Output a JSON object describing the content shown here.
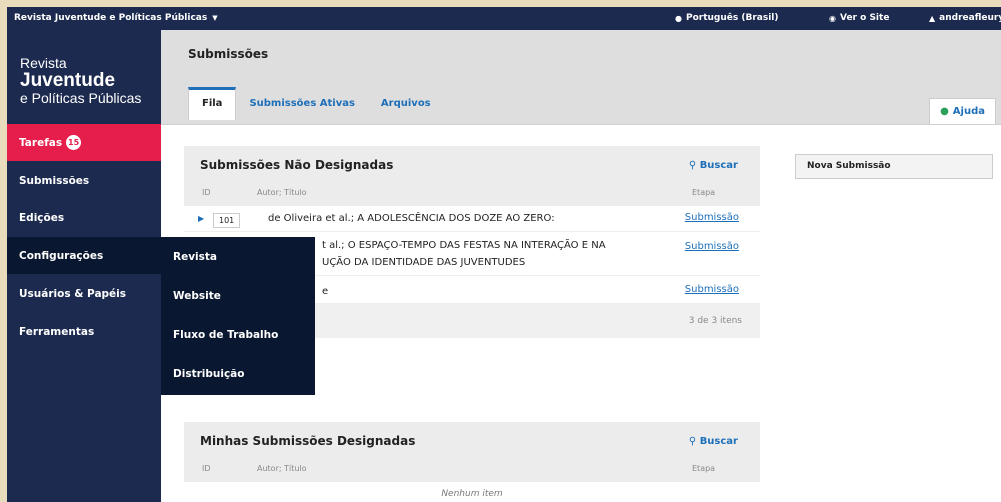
{
  "topbar": {
    "site_name": "Revista Juventude e Políticas Públicas",
    "language": "Português (Brasil)",
    "view_site": "Ver o Site",
    "user": "andreafleury"
  },
  "brand": {
    "line1": "Revista",
    "line2": "Juventude",
    "line3": "e Políticas Públicas"
  },
  "nav": {
    "tasks_label": "Tarefas",
    "tasks_count": "15",
    "items": [
      "Submissões",
      "Edições",
      "Configurações",
      "Usuários & Papéis",
      "Ferramentas"
    ]
  },
  "submenu": {
    "items": [
      "Revista",
      "Website",
      "Fluxo de Trabalho",
      "Distribuição"
    ]
  },
  "header": {
    "title": "Submissões",
    "tabs": [
      "Fila",
      "Submissões Ativas",
      "Arquivos"
    ],
    "help": "Ajuda"
  },
  "unassigned": {
    "title": "Submissões Não Designadas",
    "search": "Buscar",
    "col_id": "ID",
    "col_author": "Autor; Título",
    "col_stage": "Etapa",
    "rows": [
      {
        "id": "101",
        "title": "de Oliveira et al.; A ADOLESCÊNCIA DOS DOZE AO ZERO:",
        "stage": "Submissão"
      },
      {
        "title_line1": "t al.; O ESPAÇO-TEMPO DAS FESTAS NA INTERAÇÃO E NA",
        "title_line2": "UÇÃO DA IDENTIDADE DAS JUVENTUDES",
        "stage": "Submissão"
      },
      {
        "title": "e",
        "stage": "Submissão"
      }
    ],
    "count": "3 de 3 itens"
  },
  "assigned": {
    "title": "Minhas Submissões Designadas",
    "search": "Buscar",
    "col_id": "ID",
    "col_author": "Autor; Título",
    "col_stage": "Etapa",
    "empty": "Nenhum item"
  },
  "new_submission": "Nova Submissão",
  "colors": {
    "navy": "#1c2a4f",
    "dark_navy": "#0a1730",
    "accent_red": "#e51e4b",
    "link_blue": "#1d6fb8"
  }
}
